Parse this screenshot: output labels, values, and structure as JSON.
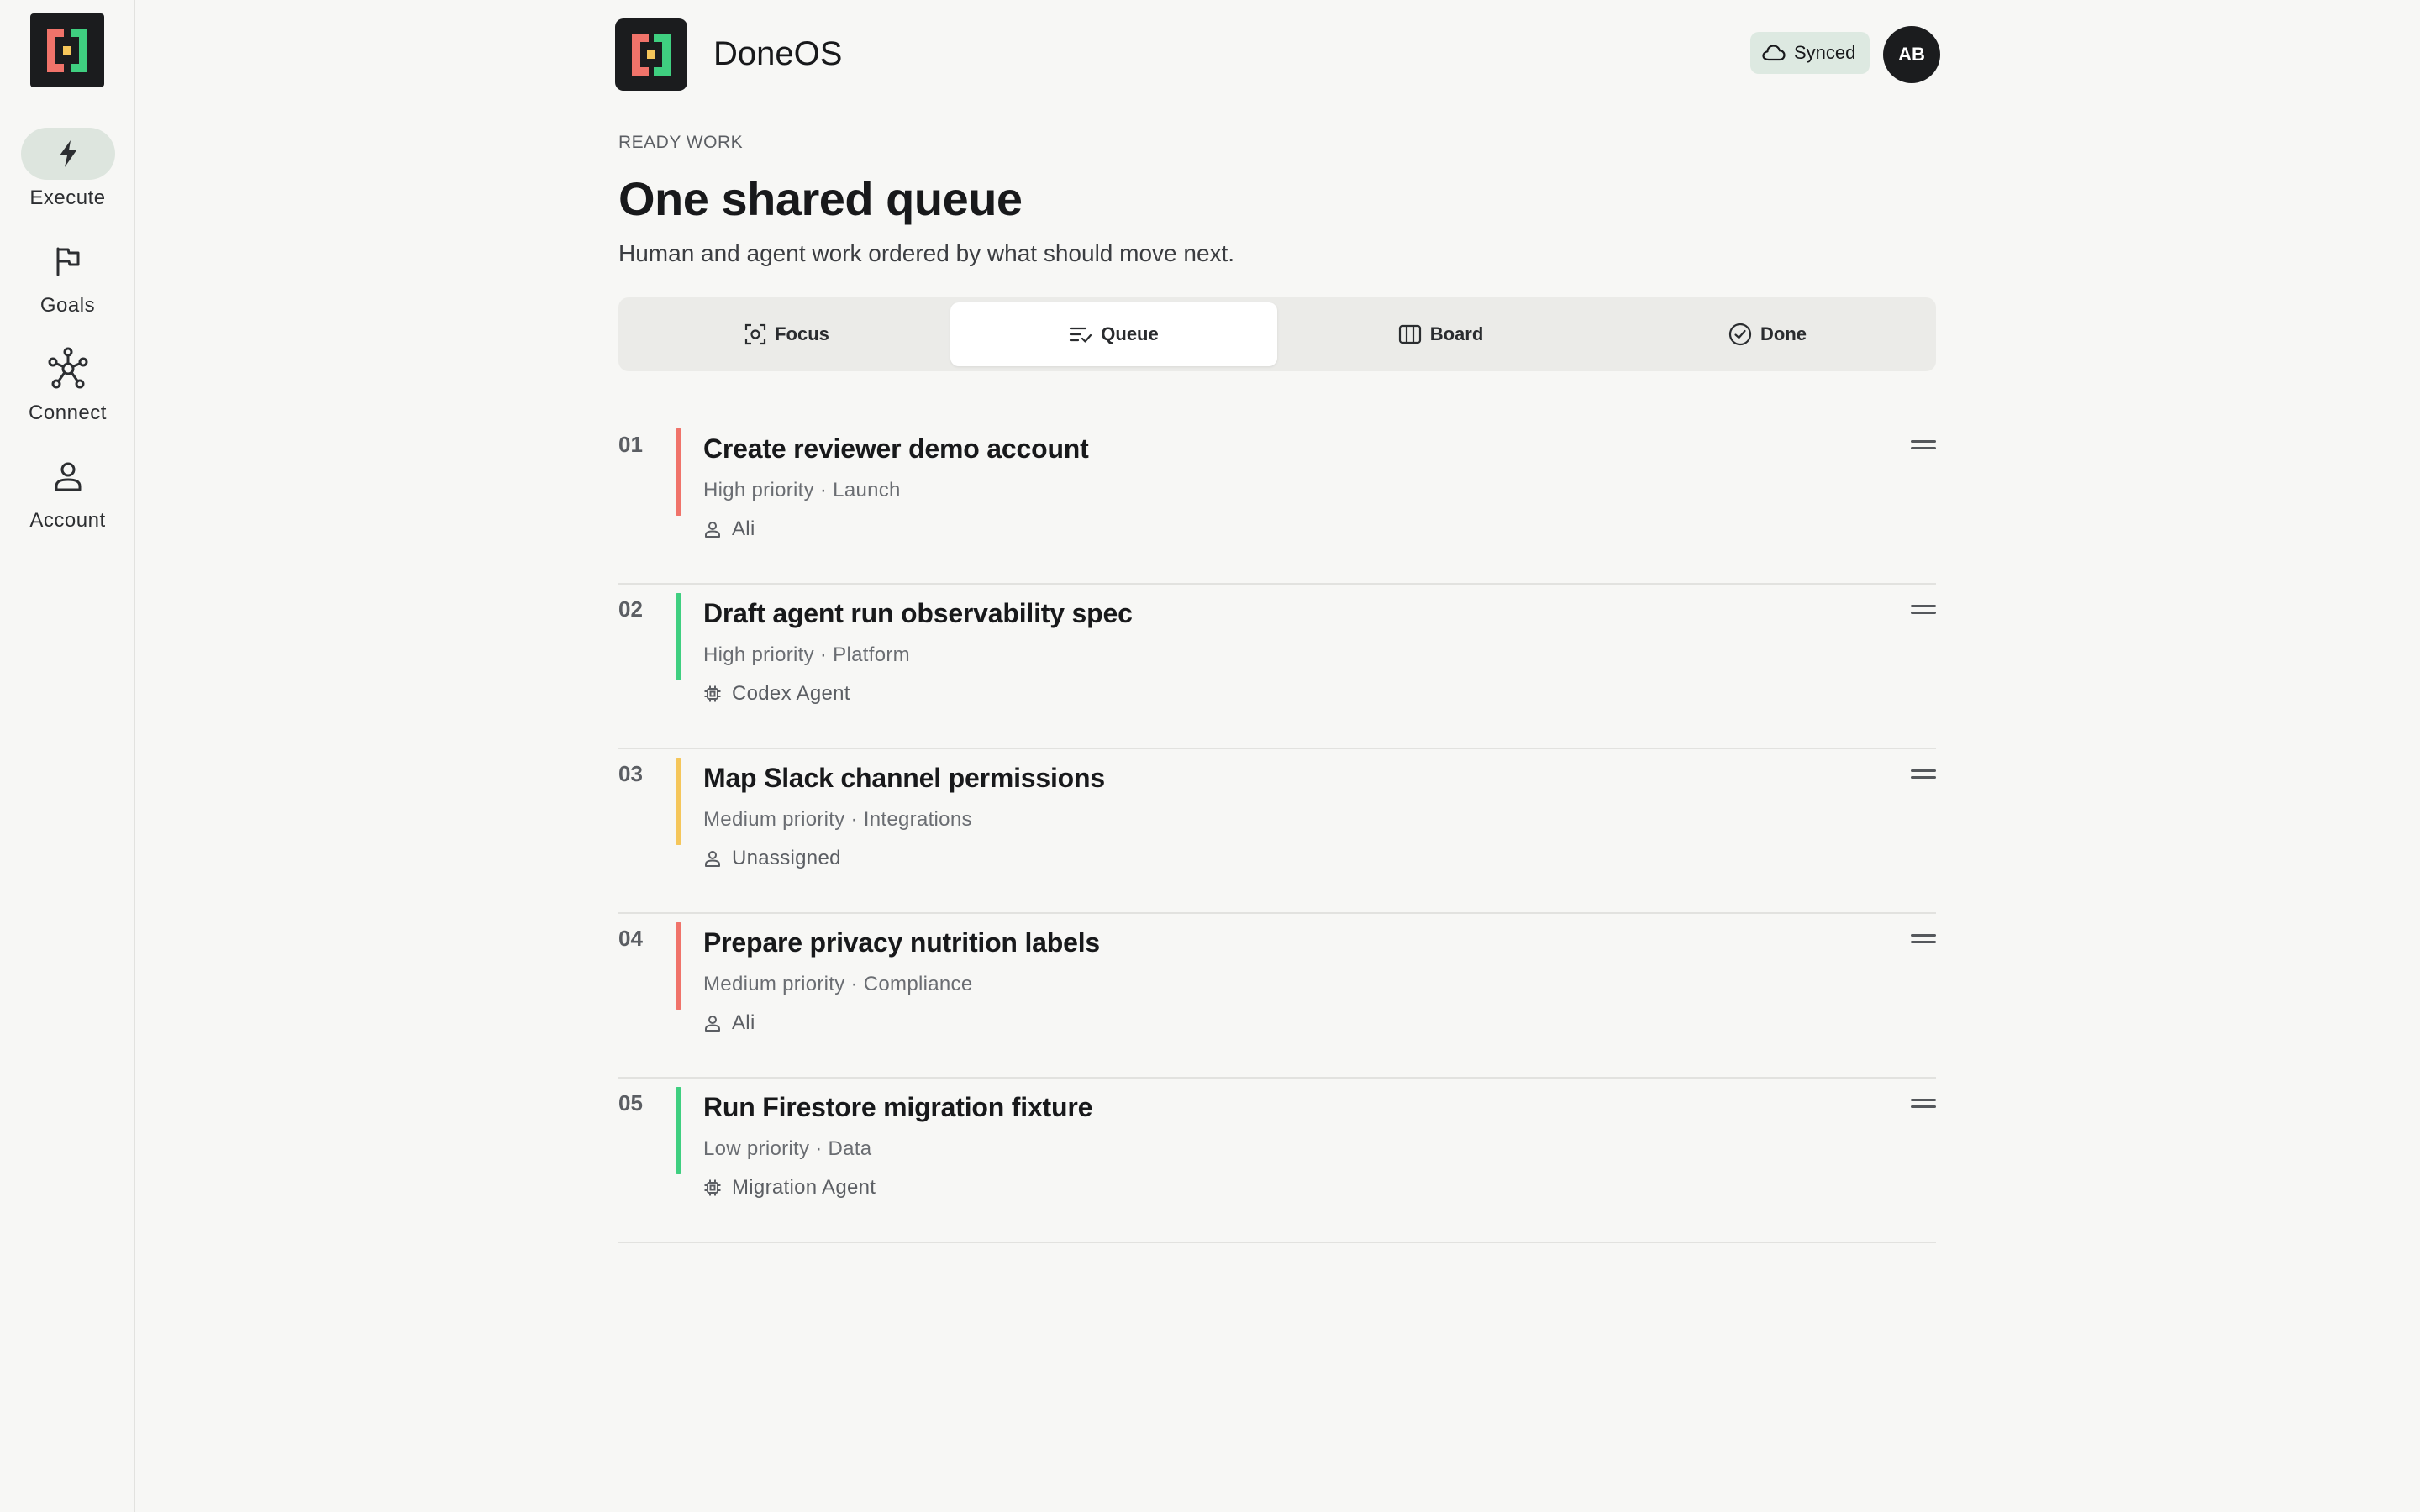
{
  "app": {
    "name": "DoneOS"
  },
  "sidebar": {
    "items": [
      {
        "label": "Execute",
        "icon": "bolt-icon",
        "active": true
      },
      {
        "label": "Goals",
        "icon": "flag-icon",
        "active": false
      },
      {
        "label": "Connect",
        "icon": "network-icon",
        "active": false
      },
      {
        "label": "Account",
        "icon": "user-icon",
        "active": false
      }
    ]
  },
  "header": {
    "sync_status": "Synced",
    "avatar_initials": "AB"
  },
  "page": {
    "eyebrow": "READY WORK",
    "title": "One shared queue",
    "subtitle": "Human and agent work ordered by what should move next."
  },
  "tabs": [
    {
      "label": "Focus",
      "icon": "focus-icon",
      "active": false
    },
    {
      "label": "Queue",
      "icon": "queue-icon",
      "active": true
    },
    {
      "label": "Board",
      "icon": "board-icon",
      "active": false
    },
    {
      "label": "Done",
      "icon": "check-circle-icon",
      "active": false
    }
  ],
  "queue": [
    {
      "num": "01",
      "title": "Create reviewer demo account",
      "meta": "High priority · Launch",
      "assignee": "Ali",
      "assignee_type": "user-icon",
      "color": "#f0736a"
    },
    {
      "num": "02",
      "title": "Draft agent run observability spec",
      "meta": "High priority · Platform",
      "assignee": "Codex Agent",
      "assignee_type": "agent-icon",
      "color": "#3fcf80"
    },
    {
      "num": "03",
      "title": "Map Slack channel permissions",
      "meta": "Medium priority · Integrations",
      "assignee": "Unassigned",
      "assignee_type": "user-icon",
      "color": "#f5c65a"
    },
    {
      "num": "04",
      "title": "Prepare privacy nutrition labels",
      "meta": "Medium priority · Compliance",
      "assignee": "Ali",
      "assignee_type": "user-icon",
      "color": "#f0736a"
    },
    {
      "num": "05",
      "title": "Run Firestore migration fixture",
      "meta": "Low priority · Data",
      "assignee": "Migration Agent",
      "assignee_type": "agent-icon",
      "color": "#3fcf80"
    }
  ],
  "colors": {
    "logo_red": "#f0736a",
    "logo_green": "#3fcf80",
    "logo_yellow": "#f5c65a",
    "active_pill": "#dde5de",
    "synced_bg": "#dde9e1"
  }
}
